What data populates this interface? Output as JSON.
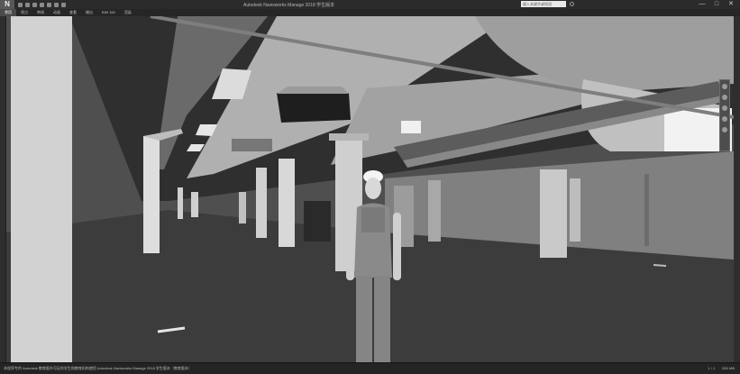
{
  "window": {
    "title": "Autodesk Navisworks Manage 2018 学生版本",
    "controls": {
      "minimize": "—",
      "maximize": "□",
      "close": "✕"
    }
  },
  "search": {
    "placeholder": "键入关键字或短语"
  },
  "ribbon": {
    "tabs": [
      {
        "label": "常用",
        "active": true
      },
      {
        "label": "视点"
      },
      {
        "label": "审阅"
      },
      {
        "label": "动画"
      },
      {
        "label": "查看"
      },
      {
        "label": "输出"
      },
      {
        "label": "BIM 360"
      },
      {
        "label": "渲染"
      }
    ]
  },
  "statusbar": {
    "message": "本程序专供 Autodesk 教育版许可证的学生和教育机构使用 Autodesk Navisworks Manage 2018 学生版本（教育版本）",
    "page": "1 / 1",
    "memory": "530 MB"
  },
  "icons": {
    "app": "navisworks-n-logo",
    "navigation": [
      "steeringwheel-icon",
      "pan-icon",
      "zoom-icon",
      "orbit-icon",
      "look-icon"
    ]
  }
}
